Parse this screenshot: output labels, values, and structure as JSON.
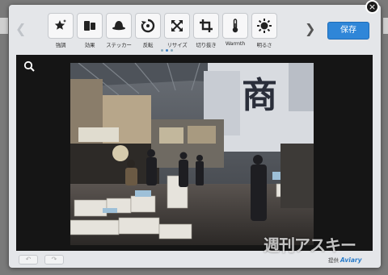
{
  "toolbar": {
    "tools": [
      {
        "label": "強調",
        "icon": "enhance-star-icon"
      },
      {
        "label": "効果",
        "icon": "effects-icon"
      },
      {
        "label": "ステッカー",
        "icon": "sticker-hat-icon"
      },
      {
        "label": "反転",
        "icon": "orientation-icon"
      },
      {
        "label": "リサイズ",
        "icon": "resize-icon"
      },
      {
        "label": "切り抜き",
        "icon": "crop-icon"
      },
      {
        "label": "Warmth",
        "icon": "thermometer-icon"
      },
      {
        "label": "明るさ",
        "icon": "brightness-icon"
      }
    ],
    "save_label": "保存",
    "close_glyph": "×",
    "prev_glyph": "❮",
    "next_glyph": "❯"
  },
  "footer": {
    "powered_label": "提供",
    "powered_brand": "Aviary",
    "undo_glyph": "↶",
    "redo_glyph": "↷"
  },
  "photo": {
    "sign_text": "商"
  },
  "watermark": {
    "text": "週刊アスキー"
  },
  "colors": {
    "save_button": "#2f86d8",
    "accent": "#3b7fc4",
    "canvas_background": "#151515"
  }
}
